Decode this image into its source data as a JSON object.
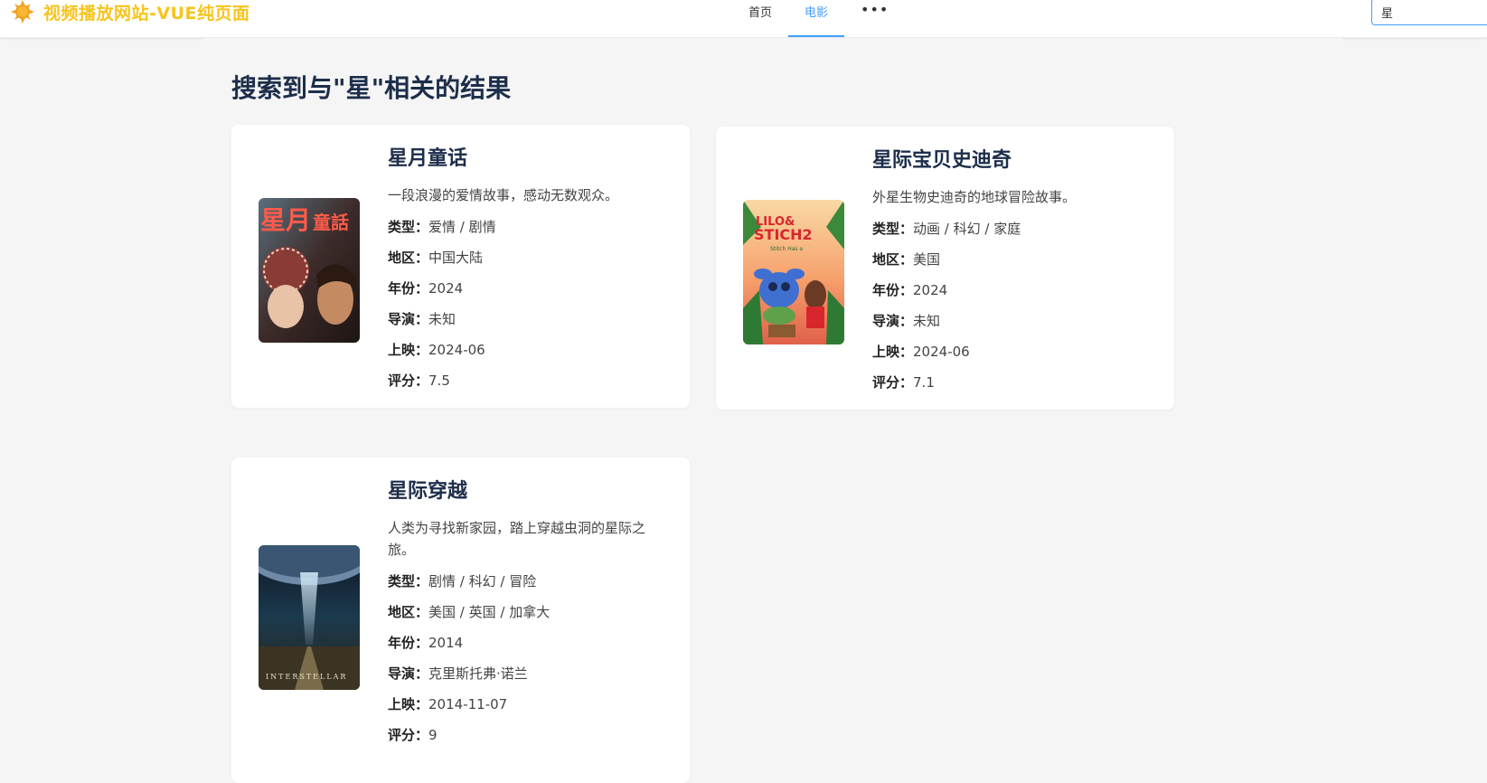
{
  "app": {
    "logo_text": "视频播放网站-VUE纯页面",
    "brand_color": "#f7c41c",
    "accent_color": "#409eff"
  },
  "nav": {
    "items": [
      {
        "label": "首页",
        "active": false
      },
      {
        "label": "电影",
        "active": true
      },
      {
        "label": "•••",
        "active": false
      }
    ]
  },
  "search": {
    "value": "星"
  },
  "main": {
    "title": "搜索到与\"星\"相关的结果",
    "field_labels": {
      "genre": "类型：",
      "region": "地区：",
      "year": "年份：",
      "director": "导演：",
      "release": "上映：",
      "rating": "评分："
    },
    "results": [
      {
        "title": "星月童话",
        "desc": "一段浪漫的爱情故事，感动无数观众。",
        "genre": "爱情 / 剧情",
        "region": "中国大陆",
        "year": "2024",
        "director": "未知",
        "release": "2024-06",
        "rating": "7.5",
        "poster_icon": "poster-romance",
        "poster_text": "星月童話"
      },
      {
        "title": "星际宝贝史迪奇",
        "desc": "外星生物史迪奇的地球冒险故事。",
        "genre": "动画 / 科幻 / 家庭",
        "region": "美国",
        "year": "2024",
        "director": "未知",
        "release": "2024-06",
        "rating": "7.1",
        "poster_icon": "poster-cartoon",
        "poster_text": "Lilo & Stitch 2"
      },
      {
        "title": "星际穿越",
        "desc": "人类为寻找新家园，踏上穿越虫洞的星际之旅。",
        "genre": "剧情 / 科幻 / 冒险",
        "region": "美国 / 英国 / 加拿大",
        "year": "2014",
        "director": "克里斯托弗·诺兰",
        "release": "2014-11-07",
        "rating": "9",
        "poster_icon": "poster-space",
        "poster_text": "INTERSTELLAR"
      }
    ]
  }
}
